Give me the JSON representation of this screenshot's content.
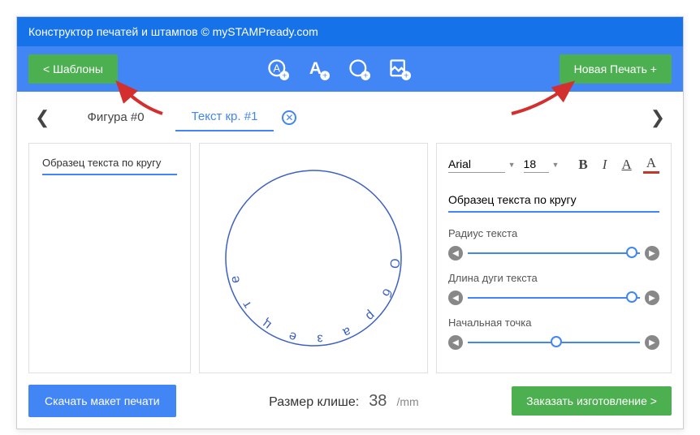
{
  "header": {
    "title": "Конструктор печатей и штампов © mySTAMPready.com"
  },
  "toolbar": {
    "templates_label": "<  Шаблоны",
    "new_stamp_label": "Новая Печать +"
  },
  "tabs": {
    "figure_label": "Фигура #0",
    "text_label": "Текст кр. #1"
  },
  "left_panel": {
    "sample_label": "Образец текста по кругу"
  },
  "preview": {
    "circle_text": "Образец текста по кругу"
  },
  "right_panel": {
    "font_name": "Arial",
    "font_size": "18",
    "bold": "B",
    "italic": "I",
    "underline": "A",
    "color": "A",
    "text_value": "Образец текста по кругу",
    "radius_label": "Радиус текста",
    "arc_label": "Длина дуги текста",
    "start_label": "Начальная точка"
  },
  "footer": {
    "download_label": "Скачать макет печати",
    "size_label": "Размер клише:",
    "size_value": "38",
    "size_unit": "/mm",
    "order_label": "Заказать изготовление >"
  }
}
